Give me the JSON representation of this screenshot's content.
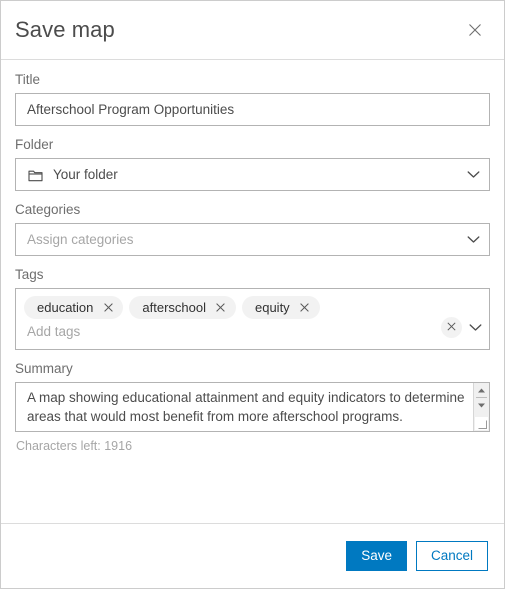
{
  "dialog": {
    "title": "Save map",
    "close_icon": "close-icon"
  },
  "form": {
    "title_field": {
      "label": "Title",
      "value": "Afterschool Program Opportunities",
      "placeholder": "Title"
    },
    "folder_field": {
      "label": "Folder",
      "value": "Your folder",
      "icon": "folder-icon",
      "chevron": "chevron-down-icon"
    },
    "categories_field": {
      "label": "Categories",
      "value": "",
      "placeholder": "Assign categories",
      "chevron": "chevron-down-icon"
    },
    "tags_field": {
      "label": "Tags",
      "placeholder": "Add tags",
      "tags": [
        {
          "label": "education",
          "remove_icon": "close-icon"
        },
        {
          "label": "afterschool",
          "remove_icon": "close-icon"
        },
        {
          "label": "equity",
          "remove_icon": "close-icon"
        }
      ],
      "clear_icon": "close-icon",
      "chevron": "chevron-down-icon"
    },
    "summary_field": {
      "label": "Summary",
      "value": "A map showing educational attainment and equity indicators to determine areas that would most benefit from more afterschool programs.",
      "characters_left": "Characters left: 1916",
      "scroll_up_icon": "caret-up-icon",
      "scroll_down_icon": "caret-down-icon",
      "resize_icon": "resize-grip-icon"
    }
  },
  "footer": {
    "save_label": "Save",
    "cancel_label": "Cancel"
  },
  "colors": {
    "accent": "#0079c1",
    "border": "#b3b3b3",
    "text": "#4c4c4c",
    "label": "#6e6e6e",
    "placeholder": "#a6a6a6",
    "chip_bg": "#f2f2f2"
  }
}
